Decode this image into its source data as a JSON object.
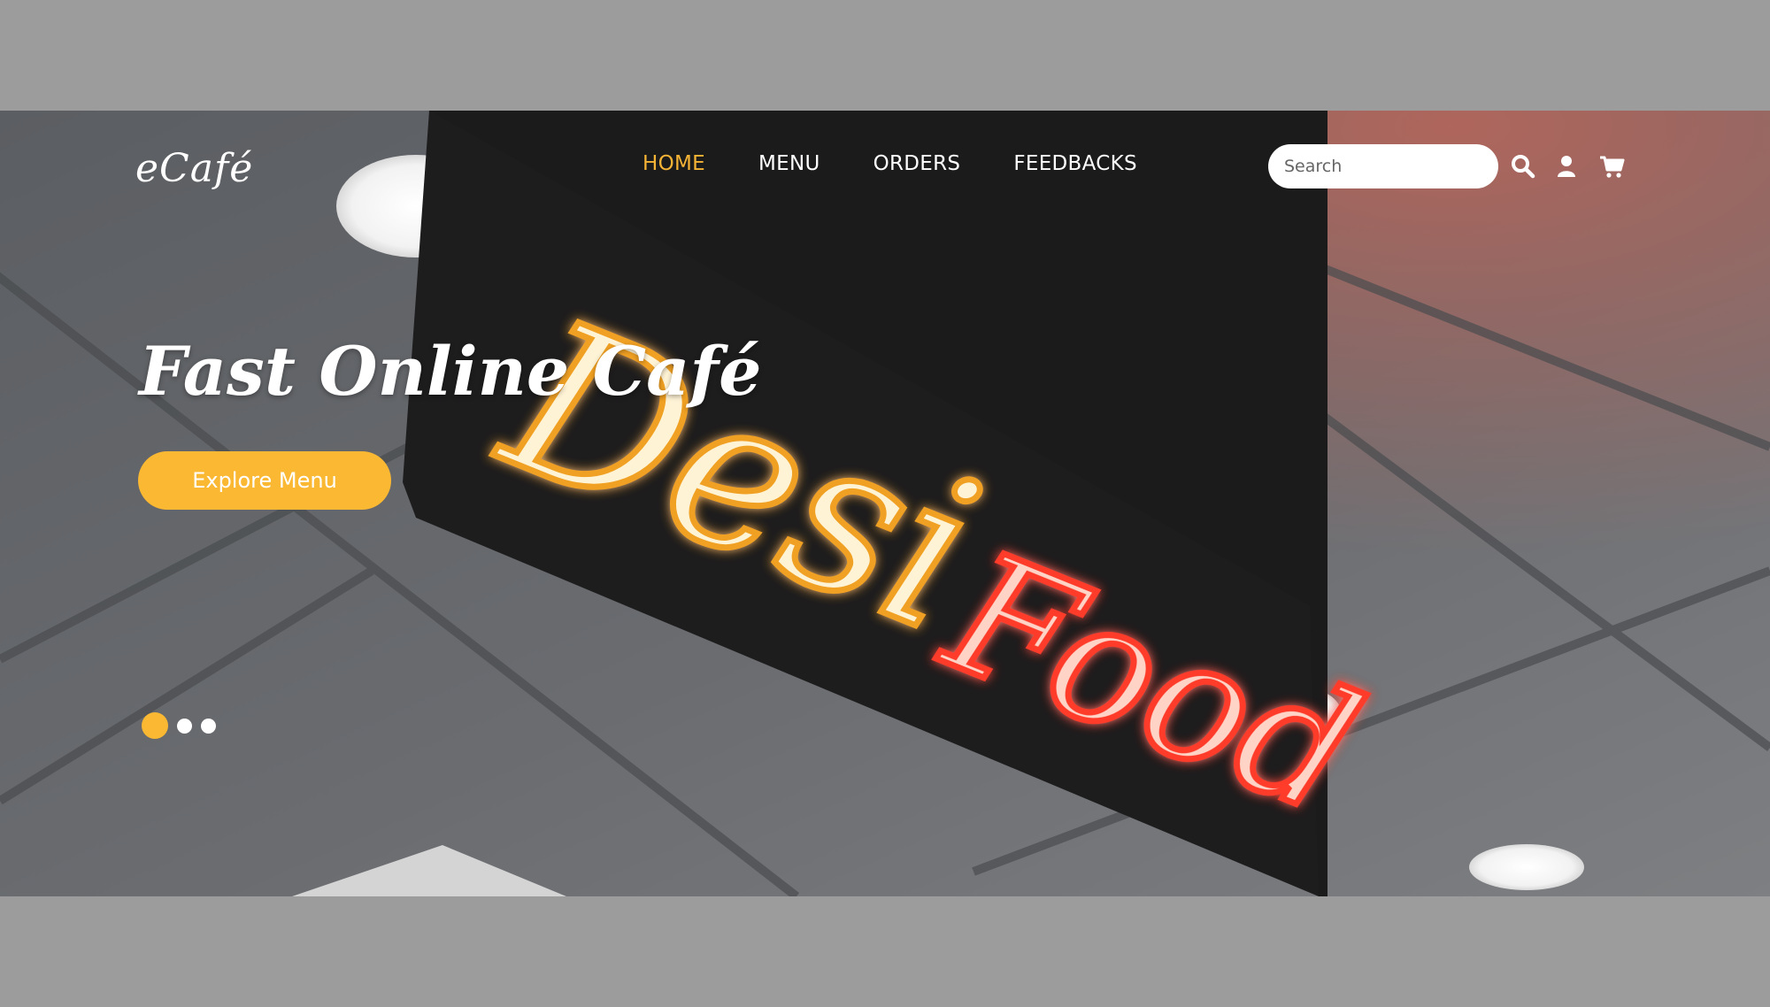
{
  "brand": {
    "logo": "eCafé"
  },
  "nav": {
    "items": [
      {
        "label": "HOME",
        "active": true
      },
      {
        "label": "MENU",
        "active": false
      },
      {
        "label": "ORDERS",
        "active": false
      },
      {
        "label": "FEEDBACKS",
        "active": false
      }
    ]
  },
  "search": {
    "placeholder": "Search",
    "value": ""
  },
  "icons": {
    "search": "search-icon",
    "user": "user-icon",
    "cart": "cart-icon"
  },
  "hero": {
    "headline": "Fast Online Café",
    "cta_label": "Explore Menu",
    "sign_text": [
      "Desi",
      "Food"
    ],
    "slides": {
      "count": 3,
      "active": 1
    }
  },
  "colors": {
    "accent": "#fbb833",
    "nav_active": "#f5b335",
    "page_background": "#9c9c9c",
    "neon_orange": "#f0a020",
    "neon_red": "#ff3a2a"
  }
}
